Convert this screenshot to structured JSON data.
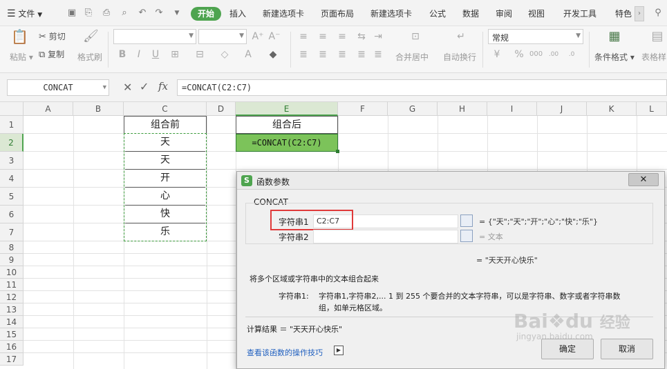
{
  "menubar": {
    "file_label": "文件",
    "tabs": [
      "开始",
      "插入",
      "新建选项卡",
      "页面布局",
      "新建选项卡",
      "公式",
      "数据",
      "审阅",
      "视图",
      "开发工具",
      "特色"
    ]
  },
  "toolbar": {
    "paste": "粘贴",
    "cut": "剪切",
    "copy": "复制",
    "format_painter": "格式刷",
    "number_format": "常规",
    "merge_center": "合并居中",
    "wrap_text": "自动换行",
    "conditional_format": "条件格式",
    "table_style": "表格样"
  },
  "formula_bar": {
    "name_box": "CONCAT",
    "fx": "fx",
    "formula": "=CONCAT(C2:C7)"
  },
  "grid": {
    "columns": [
      "A",
      "B",
      "C",
      "D",
      "E",
      "F",
      "G",
      "H",
      "I",
      "J",
      "K",
      "L"
    ],
    "rows": [
      "1",
      "2",
      "3",
      "4",
      "5",
      "6",
      "7",
      "8",
      "9",
      "10",
      "11",
      "12",
      "13",
      "14",
      "15",
      "16",
      "17"
    ],
    "c1": "组合前",
    "c_values": [
      "天",
      "天",
      "开",
      "心",
      "快",
      "乐"
    ],
    "e1": "组合后",
    "e2": "=CONCAT(C2:C7)"
  },
  "dialog": {
    "title": "函数参数",
    "function_name": "CONCAT",
    "arg1_label": "字符串1",
    "arg1_value": "C2:C7",
    "arg1_result": "= {\"天\";\"天\";\"开\";\"心\";\"快\";\"乐\"}",
    "arg2_label": "字符串2",
    "arg2_result": "= 文本",
    "overall_result": "= \"天天开心快乐\"",
    "description": "将多个区域或字符串中的文本组合起来",
    "arg_help_label": "字符串1:",
    "arg_help_line1": "字符串1,字符串2,... 1 到 255 个要合并的文本字符串，可以是字符串、数字或者字符串数",
    "arg_help_line2": "组，如单元格区域。",
    "calc_result": "计算结果 ＝ \"天天开心快乐\"",
    "help_link": "查看该函数的操作技巧",
    "ok": "确定",
    "cancel": "取消"
  },
  "watermark": {
    "brand": "Bai",
    "brand2": "du",
    "jingyan": "经验",
    "url": "jingyan.baidu.com"
  },
  "colors": {
    "accent_green": "#4ea44f",
    "active_header": "#dbe8d3",
    "annotation_red": "#e03a3a"
  }
}
